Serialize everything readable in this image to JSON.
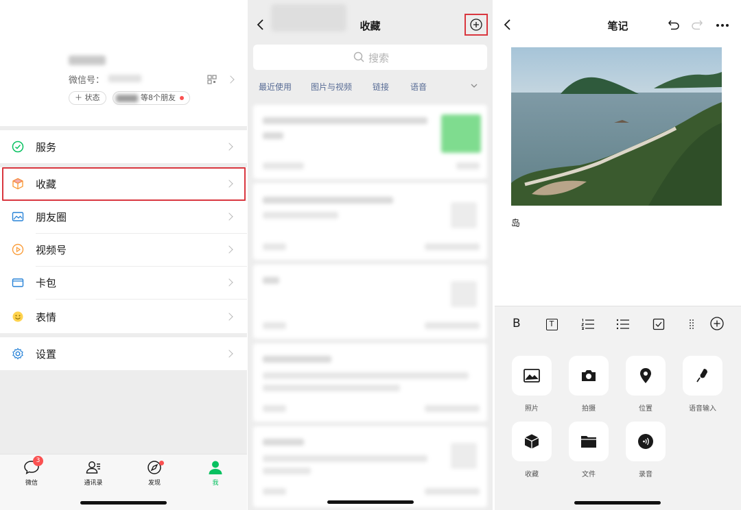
{
  "panel_me": {
    "wechat_id_label": "微信号：",
    "status_button": "＋ 状态",
    "friends_text": "等8个朋友",
    "menu": [
      {
        "label": "服务"
      },
      {
        "label": "收藏"
      },
      {
        "label": "朋友圈"
      },
      {
        "label": "视频号"
      },
      {
        "label": "卡包"
      },
      {
        "label": "表情"
      },
      {
        "label": "设置"
      }
    ],
    "tabs": [
      {
        "label": "微信",
        "badge": "3"
      },
      {
        "label": "通讯录"
      },
      {
        "label": "发现"
      },
      {
        "label": "我"
      }
    ],
    "colors": {
      "accent": "#07c160",
      "highlight": "#d9363e",
      "badge": "#fa5151"
    }
  },
  "panel_favorites": {
    "title": "收藏",
    "search_placeholder": "搜索",
    "filters": [
      "最近使用",
      "图片与视频",
      "链接",
      "语音"
    ]
  },
  "panel_note": {
    "title": "笔记",
    "note_text": "岛",
    "format_bold": "B",
    "format_title": "T",
    "attachments": [
      {
        "label": "照片",
        "icon": "image-icon"
      },
      {
        "label": "拍摄",
        "icon": "camera-icon"
      },
      {
        "label": "位置",
        "icon": "location-pin-icon"
      },
      {
        "label": "语音输入",
        "icon": "microphone-icon"
      },
      {
        "label": "收藏",
        "icon": "cube-icon"
      },
      {
        "label": "文件",
        "icon": "folder-icon"
      },
      {
        "label": "录音",
        "icon": "audio-record-icon"
      }
    ]
  }
}
